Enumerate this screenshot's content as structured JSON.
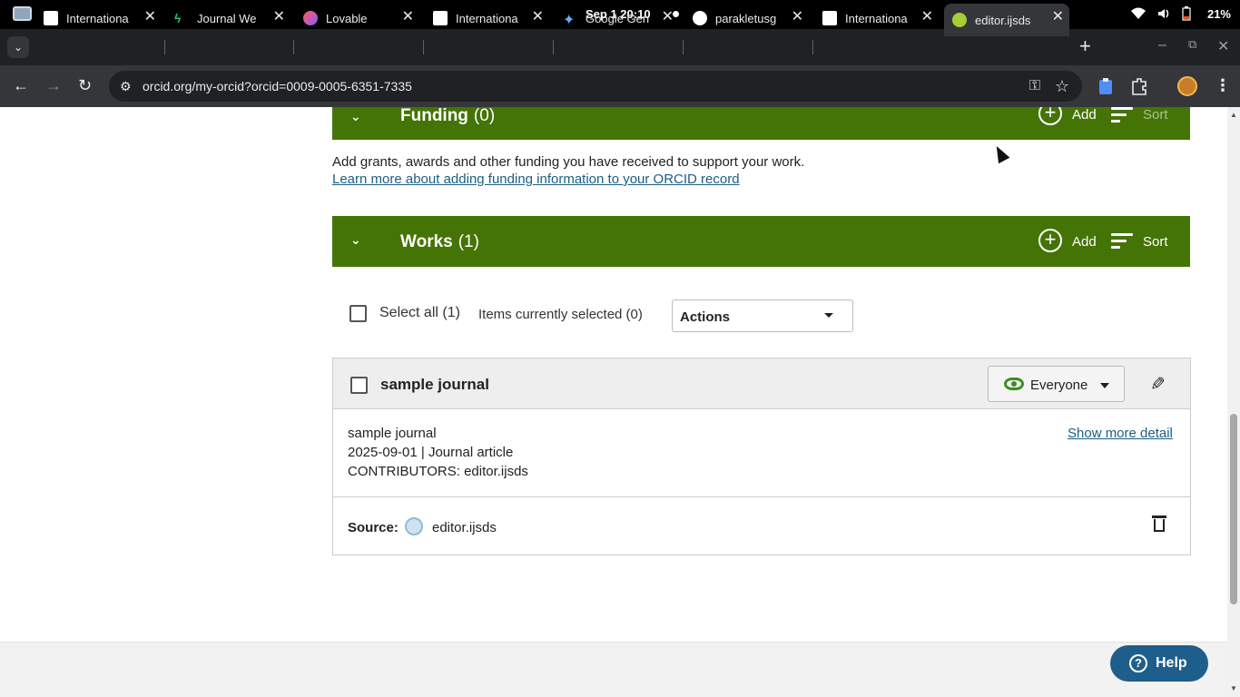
{
  "os": {
    "clock": "Sep 1  20:10",
    "battery": "21%"
  },
  "tabs": [
    {
      "title": "Internationa",
      "favicon": "ijsds-icon"
    },
    {
      "title": "Journal We",
      "favicon": "bolt-icon"
    },
    {
      "title": "Lovable",
      "favicon": "lovable-heart-icon"
    },
    {
      "title": "Internationa",
      "favicon": "ijsds-icon"
    },
    {
      "title": "Google Gen",
      "favicon": "gemini-icon"
    },
    {
      "title": "parakletusg",
      "favicon": "github-icon"
    },
    {
      "title": "Internationa",
      "favicon": "ijsds-icon"
    },
    {
      "title": "editor.ijsds",
      "favicon": "orcid-icon",
      "active": true
    }
  ],
  "address": {
    "url": "orcid.org/my-orcid?orcid=0009-0005-6351-7335"
  },
  "funding": {
    "title": "Funding",
    "count": "(0)",
    "add_label": "Add",
    "sort_label": "Sort",
    "description": "Add grants, awards and other funding you have received to support your work.",
    "learn_more": "Learn more about adding funding information to your ORCID record"
  },
  "works": {
    "title": "Works",
    "count": "(1)",
    "add_label": "Add",
    "sort_label": "Sort",
    "select_all": "Select all (1)",
    "selected_count": "Items currently selected (0)",
    "actions_label": "Actions",
    "items": [
      {
        "title": "sample journal",
        "visibility": "Everyone",
        "journal": "sample journal",
        "meta": "2025-09-01 | Journal article",
        "contributors": "CONTRIBUTORS: editor.ijsds",
        "show_more": "Show more detail",
        "source_label": "Source:",
        "source_name": "editor.ijsds"
      }
    ]
  },
  "help": {
    "label": "Help"
  },
  "colors": {
    "section_green": "#447405",
    "link_blue": "#1a5e84",
    "help_blue": "#1d5f8a"
  }
}
